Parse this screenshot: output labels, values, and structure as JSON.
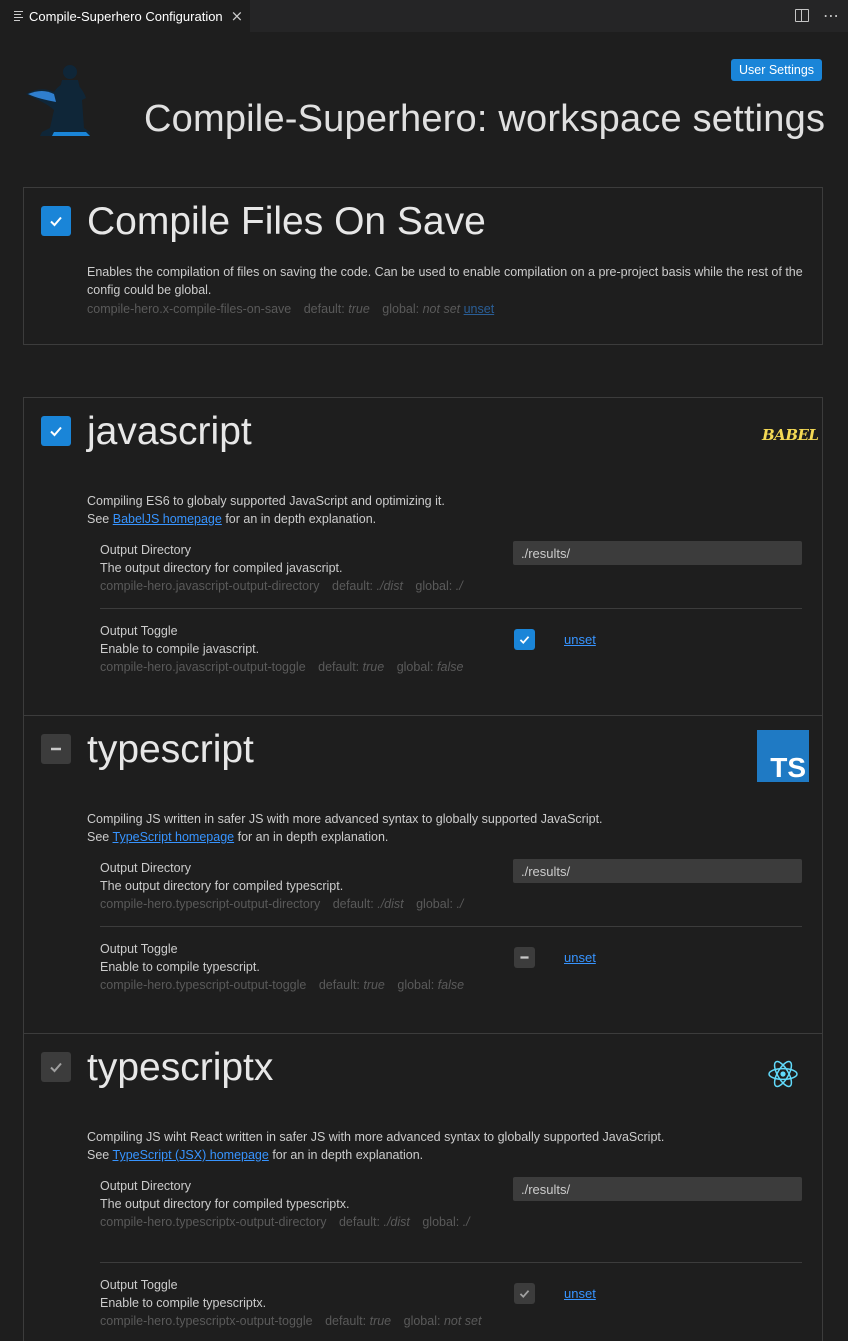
{
  "tab": {
    "label": "Compile-Superhero Configuration",
    "close": "×"
  },
  "toolbar": {
    "more": "⋯"
  },
  "header": {
    "user_settings": "User Settings",
    "title": "Compile-Superhero: workspace settings"
  },
  "compile_on_save": {
    "title": "Compile Files On Save",
    "checked": true,
    "description": "Enables the compilation of files on saving the code. Can be used to enable compilation on a pre-project basis while the rest of the config could be global.",
    "key": "compile-hero.x-compile-files-on-save",
    "default_label": "default:",
    "default_value": "true",
    "global_label": "global:",
    "global_value": "not set",
    "unset": "unset"
  },
  "sections": [
    {
      "title": "javascript",
      "state": "checked",
      "logo": "BABEL",
      "description": "Compiling ES6 to globaly supported JavaScript and optimizing it.",
      "see": "See",
      "link": "BabelJS homepage",
      "after_link": "for an in depth explanation.",
      "output_directory": {
        "name": "Output Directory",
        "desc": "The output directory for compiled javascript.",
        "key": "compile-hero.javascript-output-directory",
        "default_label": "default:",
        "default_value": "./dist",
        "global_label": "global:",
        "global_value": "./",
        "value": "./results/"
      },
      "output_toggle": {
        "name": "Output Toggle",
        "desc": "Enable to compile javascript.",
        "key": "compile-hero.javascript-output-toggle",
        "default_label": "default:",
        "default_value": "true",
        "global_label": "global:",
        "global_value": "false",
        "state": "checked",
        "unset": "unset"
      }
    },
    {
      "title": "typescript",
      "state": "indeterminate",
      "logo": "TS",
      "description": "Compiling JS written in safer JS with more advanced syntax to globally supported JavaScript.",
      "see": "See",
      "link": "TypeScript homepage",
      "after_link": "for an in depth explanation.",
      "output_directory": {
        "name": "Output Directory",
        "desc": "The output directory for compiled typescript.",
        "key": "compile-hero.typescript-output-directory",
        "default_label": "default:",
        "default_value": "./dist",
        "global_label": "global:",
        "global_value": "./",
        "value": "./results/"
      },
      "output_toggle": {
        "name": "Output Toggle",
        "desc": "Enable to compile typescript.",
        "key": "compile-hero.typescript-output-toggle",
        "default_label": "default:",
        "default_value": "true",
        "global_label": "global:",
        "global_value": "false",
        "state": "indeterminate",
        "unset": "unset"
      }
    },
    {
      "title": "typescriptx",
      "state": "disabled-checked",
      "logo": "react-icon",
      "description": "Compiling JS wiht React written in safer JS with more advanced syntax to globally supported JavaScript.",
      "see": "See",
      "link": "TypeScript (JSX) homepage",
      "after_link": "for an in depth explanation.",
      "output_directory": {
        "name": "Output Directory",
        "desc": "The output directory for compiled typescriptx.",
        "key": "compile-hero.typescriptx-output-directory",
        "default_label": "default:",
        "default_value": "./dist",
        "global_label": "global:",
        "global_value": "./",
        "value": "./results/"
      },
      "output_toggle": {
        "name": "Output Toggle",
        "desc": "Enable to compile typescriptx.",
        "key": "compile-hero.typescriptx-output-toggle",
        "default_label": "default:",
        "default_value": "true",
        "global_label": "global:",
        "global_value": "not set",
        "state": "disabled-checked",
        "unset": "unset"
      }
    }
  ],
  "colors": {
    "accent": "#1a85d8",
    "link": "#3794ff",
    "babel": "#f5da55",
    "ts": "#1f7ac4",
    "react": "#61dafb"
  }
}
